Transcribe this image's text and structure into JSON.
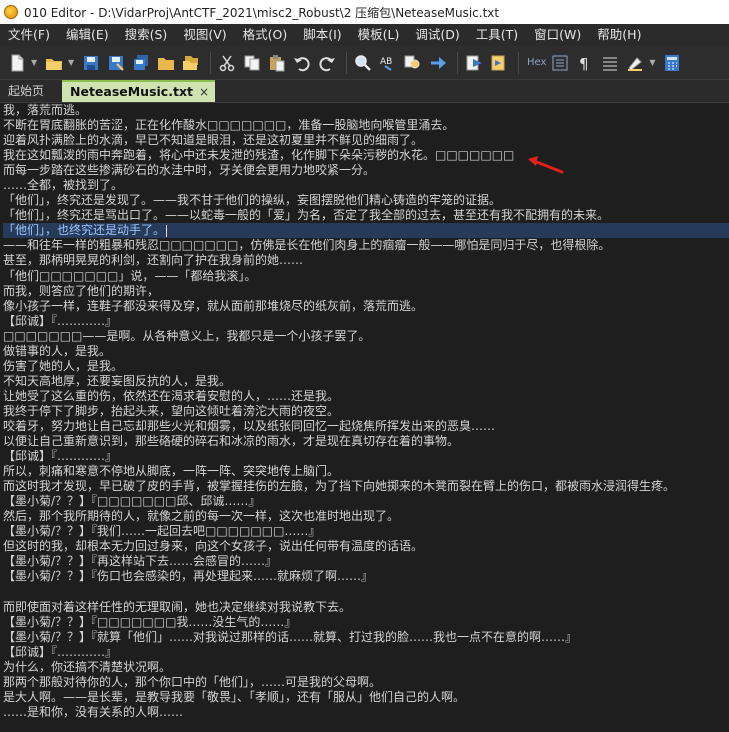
{
  "window": {
    "title": "010 Editor - D:\\VidarProj\\AntCTF_2021\\misc2_Robust\\2 压缩包\\NeteaseMusic.txt"
  },
  "menu": [
    "文件(F)",
    "编辑(E)",
    "搜索(S)",
    "视图(V)",
    "格式(O)",
    "脚本(I)",
    "模板(L)",
    "调试(D)",
    "工具(T)",
    "窗口(W)",
    "帮助(H)"
  ],
  "toolbar": {
    "hex_label": "Hex"
  },
  "tabs": {
    "start": "起始页",
    "file": "NeteaseMusic.txt",
    "close": "×"
  },
  "colors": {
    "accent_tab": "#cfe3b0",
    "highlight": "#263a5a",
    "arrow": "#e0201a"
  },
  "editor": {
    "lines": [
      "我，落荒而逃。",
      "不断在胃底翻胀的苦涩，正在化作酸水□□□□□□□，准备一股脑地向喉管里涌去。",
      "迎着风扑满脸上的水滴，早已不知道是眼泪，还是这初夏里并不鲜见的细雨了。",
      "我在这如瓢泼的雨中奔跑着，将心中还未发泄的残渣，化作脚下朵朵污秽的水花。□□□□□□□",
      "而每一步踏在这些掺满砂石的水洼中时，牙关便会更用力地咬紧一分。",
      "……全都，被找到了。",
      "「他们」，终究还是发现了。——我不甘于他们的操纵，妄图摆脱他们精心铸造的牢笼的证据。",
      "「他们」，终究还是骂出口了。——以蛇毒一般的「爱」为名，否定了我全部的过去，甚至还有我不配拥有的未来。",
      "「他们」，也终究还是动手了。",
      "——和往年一样的粗暴和残忍□□□□□□□，仿佛是长在他们肉身上的痼瘤一般——哪怕是同归于尽，也得根除。",
      "甚至，那柄明晃晃的利剑，还割向了护在我身前的她……",
      "「他们□□□□□□□」说，——「都给我滚」。",
      "而我，则答应了他们的期许，",
      "像小孩子一样，连鞋子都没来得及穿，就从面前那堆烧尽的纸灰前，落荒而逃。",
      "【邱诚】『…………』",
      "□□□□□□□——是啊。从各种意义上，我都只是一个小孩子罢了。",
      "做错事的人，是我。",
      "伤害了她的人，是我。",
      "不知天高地厚，还要妄图反抗的人，是我。",
      "让她受了这么重的伤，依然还在渴求着安慰的人，……还是我。",
      "我终于停下了脚步，抬起头来，望向这倾吐着滂沱大雨的夜空。",
      "咬着牙，努力地让自己忘却那些火光和烟雾，以及纸张同回忆一起烧焦所挥发出来的恶臭……",
      "以便让自己重新意识到，那些硌硬的碎石和冰凉的雨水，才是现在真切存在着的事物。",
      "【邱诚】『…………』",
      "所以，刺痛和寒意不停地从脚底，一阵一阵、突突地传上脑门。",
      "而这时我才发现，早已破了皮的手背，被掌握挂伤的左臉，为了挡下向她掷来的木凳而裂在臂上的伤口，都被雨水浸润得生疼。",
      "【墨小菊/？？】『□□□□□□□邱、邱诚……』",
      "然后，那个我所期待的人，就像之前的每一次一样，这次也准时地出现了。",
      "【墨小菊/？？】『我们……一起回去吧□□□□□□□……』",
      "但这时的我，却根本无力回过身来，向这个女孩子，说出任何带有温度的话语。",
      "【墨小菊/？？】『再这样站下去……会感冒的……』",
      "【墨小菊/？？】『伤口也会感染的，再处理起来……就麻烦了啊……』",
      "",
      "而即使面对着这样任性的无理取闹，她也决定继续对我说教下去。",
      "【墨小菊/？？】『□□□□□□□我……没生气的……』",
      "【墨小菊/？？】『就算「他们」……对我说过那样的话……就算、打过我的脸……我也一点不在意的啊……』",
      "【邱诚】『…………』",
      "为什么，你还搞不清楚状况啊。",
      "那两个那般对待你的人，那个你口中的「他们」，……可是我的父母啊。",
      "是大人啊。——是长辈，是教导我要「敬畏」、「孝顺」，还有「服从」他们自己的人啊。",
      "……是和你，没有关系的人啊……"
    ]
  }
}
